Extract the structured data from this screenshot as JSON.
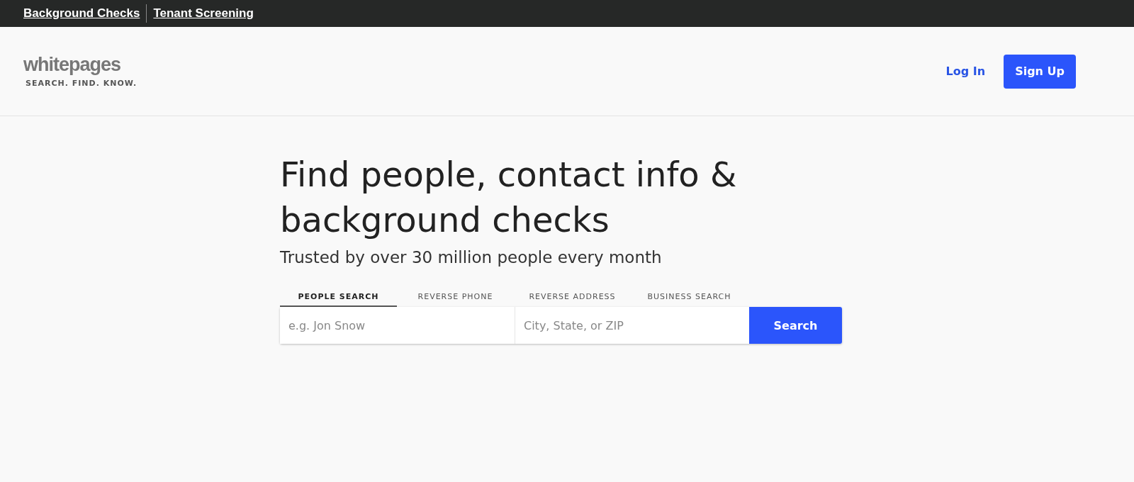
{
  "top_links": [
    "Background Checks",
    "Tenant Screening"
  ],
  "logo": {
    "name": "whitepages",
    "tagline": "SEARCH. FIND. KNOW."
  },
  "nav": {
    "login": "Log In",
    "signup": "Sign Up"
  },
  "hero": {
    "title_lines": [
      "Find people, contact info &",
      "background checks"
    ],
    "subtitle": "Trusted by over 30 million people every month"
  },
  "tabs": [
    {
      "label": "PEOPLE SEARCH",
      "selected": true
    },
    {
      "label": "REVERSE PHONE",
      "selected": false
    },
    {
      "label": "REVERSE ADDRESS",
      "selected": false
    },
    {
      "label": "BUSINESS SEARCH",
      "selected": false
    }
  ],
  "search": {
    "name_placeholder": "e.g. Jon Snow",
    "location_placeholder": "City, State, or ZIP",
    "button": "Search"
  }
}
